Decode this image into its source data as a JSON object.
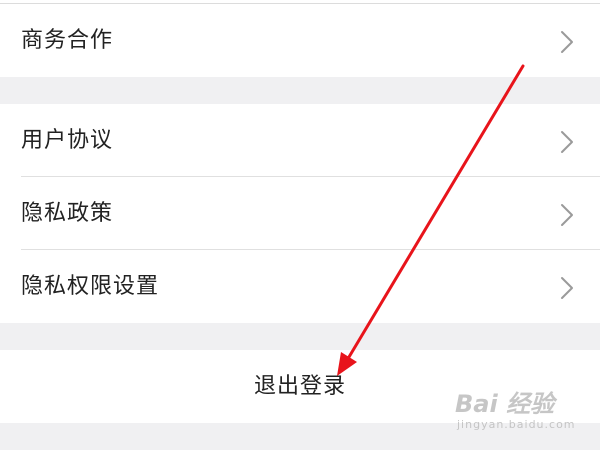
{
  "menu": {
    "top_item": {
      "label": "商务合作",
      "icon": "chevron-right-icon"
    },
    "items": [
      {
        "label": "用户协议",
        "icon": "chevron-right-icon"
      },
      {
        "label": "隐私政策",
        "icon": "chevron-right-icon"
      },
      {
        "label": "隐私权限设置",
        "icon": "chevron-right-icon"
      }
    ],
    "logout_label": "退出登录"
  },
  "annotation": {
    "arrow_color": "#e8141b"
  },
  "watermark": {
    "main": "Bai 经验",
    "sub": "jingyan.baidu.com"
  },
  "colors": {
    "background": "#f0f0f2",
    "card": "#ffffff",
    "text": "#222222",
    "divider": "#e0e0e0",
    "chevron": "#9a9a9a"
  }
}
